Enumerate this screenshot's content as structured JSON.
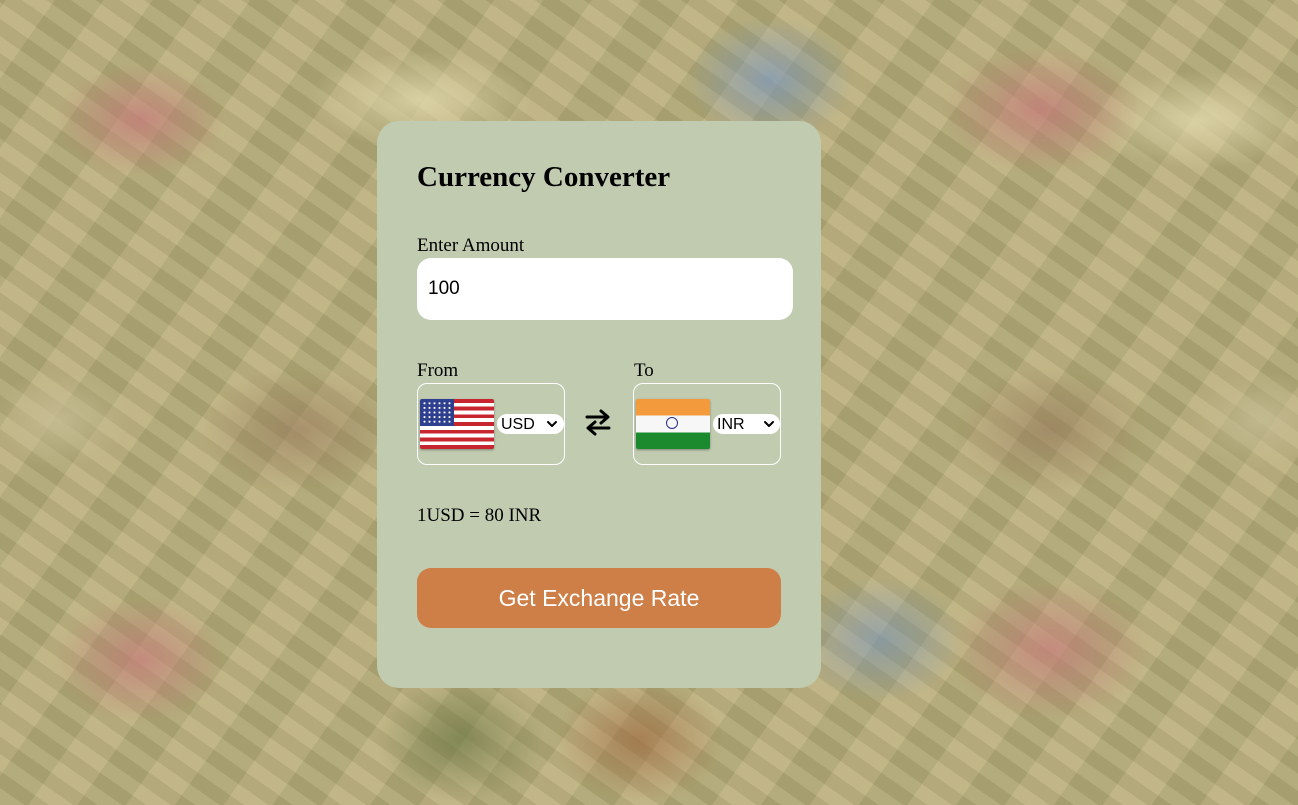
{
  "converter": {
    "title": "Currency Converter",
    "amount_label": "Enter Amount",
    "amount_value": "100",
    "from": {
      "label": "From",
      "currency": "USD",
      "flag_icon": "us-flag-icon"
    },
    "to": {
      "label": "To",
      "currency": "INR",
      "flag_icon": "india-flag-icon"
    },
    "swap_icon": "swap-arrows-icon",
    "rate_text": "1USD = 80 INR",
    "button_label": "Get Exchange Rate"
  },
  "colors": {
    "card_background": "#c0cbb0",
    "button_background": "#cd7f47",
    "button_text": "#ffffff"
  }
}
